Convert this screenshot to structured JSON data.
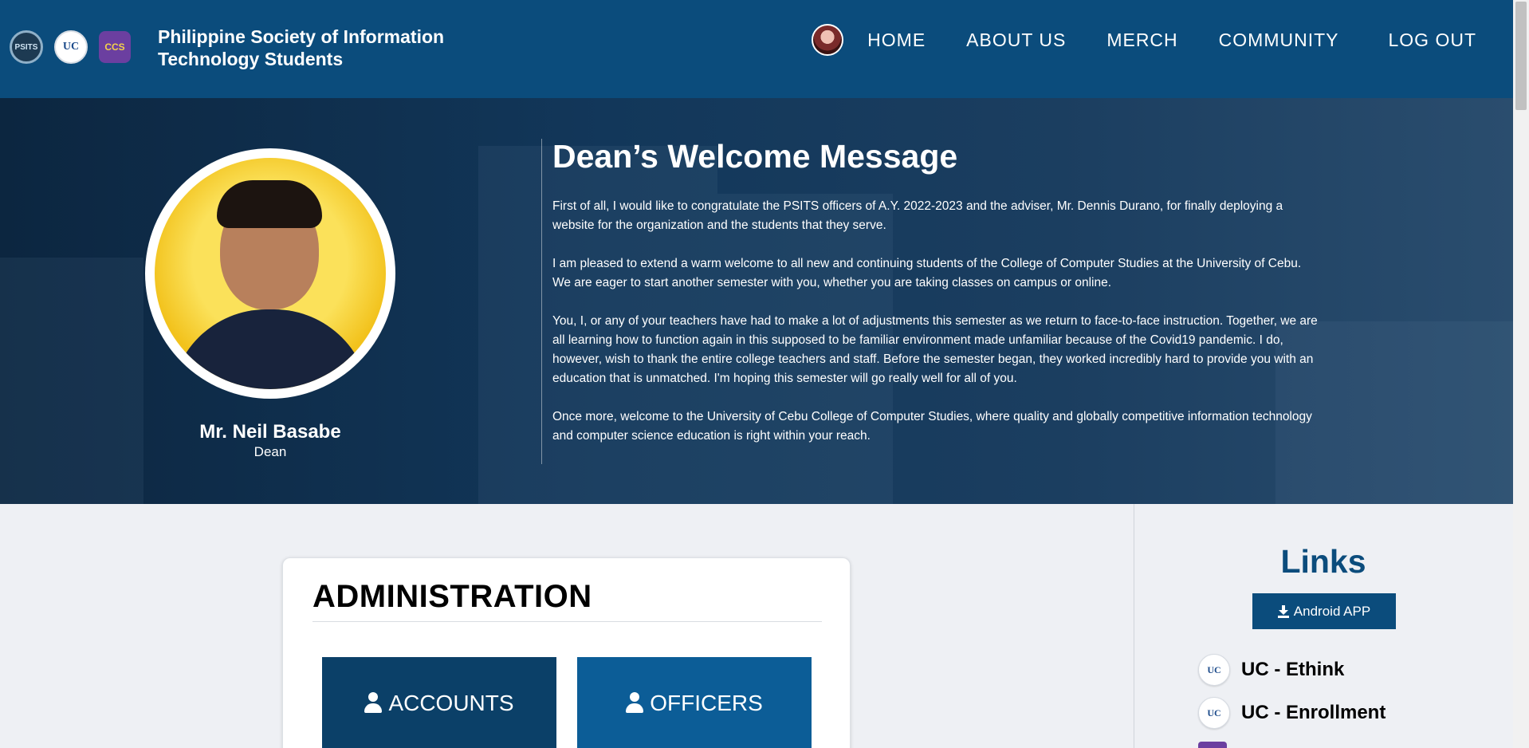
{
  "header": {
    "logos": [
      "PSITS",
      "UC",
      "CCS"
    ],
    "org_name_line1": "Philippine Society of Information",
    "org_name_line2": "Technology Students",
    "nav": [
      "HOME",
      "ABOUT US",
      "MERCH",
      "COMMUNITY",
      "LOG OUT"
    ]
  },
  "hero": {
    "title": "Dean’s Welcome Message",
    "dean_name": "Mr. Neil Basabe",
    "dean_title": "Dean",
    "paragraphs": [
      "First of all, I would like to congratulate the PSITS officers of A.Y. 2022-2023 and the adviser, Mr. Dennis Durano, for finally deploying a website for the organization and the students that they serve.",
      "I am pleased to extend a warm welcome to all new and continuing students of the College of Computer Studies at the University of Cebu. We are eager to start another semester with you, whether you are taking classes on campus or online.",
      "You, I, or any of your teachers have had to make a lot of adjustments this semester as we return to face-to-face instruction. Together, we are all learning how to function again in this supposed to be familiar environment made unfamiliar because of the Covid19 pandemic. I do, however, wish to thank the entire college teachers and staff. Before the semester began, they worked incredibly hard to provide you with an education that is unmatched. I'm hoping this semester will go really well for all of you.",
      "Once more, welcome to the University of Cebu College of Computer Studies, where quality and globally competitive information technology and computer science education is right within your reach."
    ]
  },
  "admin": {
    "title": "ADMINISTRATION",
    "accounts_label": "ACCOUNTS",
    "officers_label": "OFFICERS"
  },
  "sidebar": {
    "title": "Links",
    "android_label": "Android APP",
    "links": [
      {
        "icon_text": "UC",
        "label": "UC - Ethink"
      },
      {
        "icon_text": "UC",
        "label": "UC - Enrollment"
      }
    ]
  },
  "colors": {
    "header_bg": "#0b4c7c",
    "accounts_bg": "#0b4068",
    "officers_bg": "#0c5d97"
  }
}
